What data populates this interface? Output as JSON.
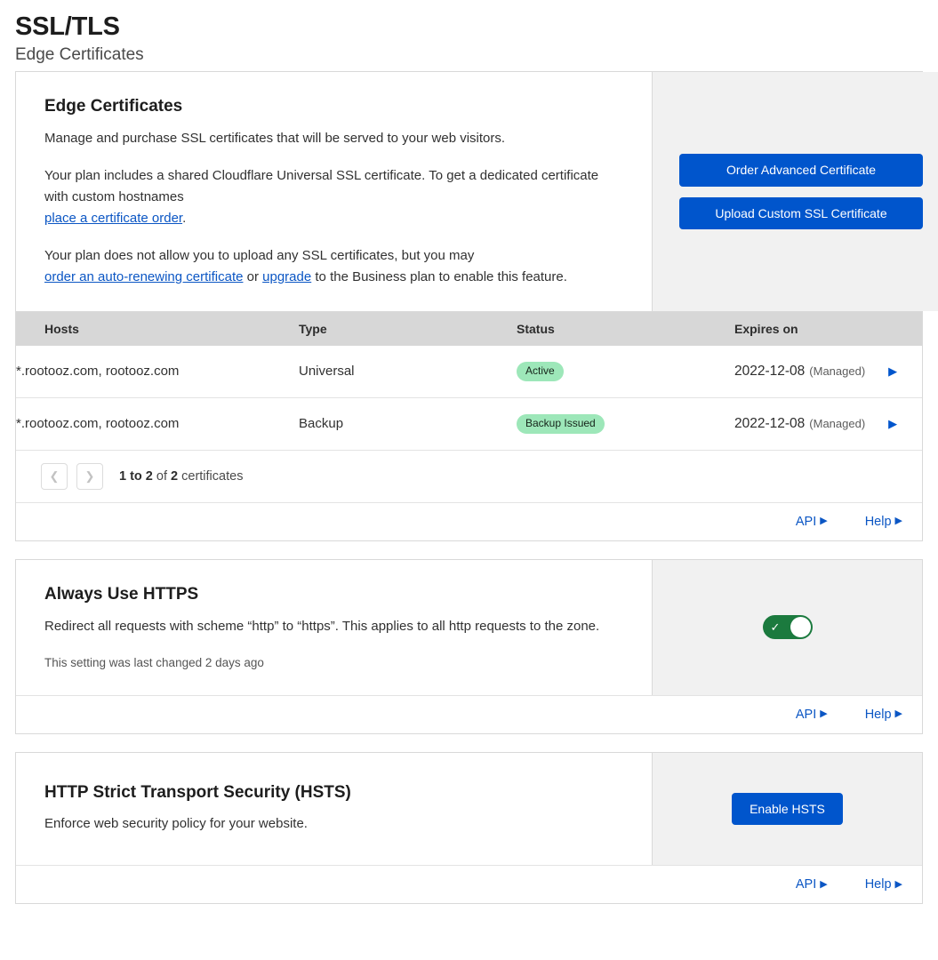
{
  "header": {
    "title": "SSL/TLS",
    "subtitle": "Edge Certificates"
  },
  "edge_certificates": {
    "title": "Edge Certificates",
    "desc_1": "Manage and purchase SSL certificates that will be served to your web visitors.",
    "desc_2_part1": "Your plan includes a shared Cloudflare Universal SSL certificate. To get a dedicated certificate with custom hostnames",
    "desc_2_link": "place a certificate order",
    "desc_2_end": ".",
    "desc_3_part1": "Your plan does not allow you to upload any SSL certificates, but you may",
    "desc_3_link1": "order an auto-renewing certificate",
    "desc_3_mid": " or ",
    "desc_3_link2": "upgrade",
    "desc_3_end": " to the Business plan to enable this feature.",
    "order_button": "Order Advanced Certificate",
    "upload_button": "Upload Custom SSL Certificate",
    "table": {
      "columns": [
        "Hosts",
        "Type",
        "Status",
        "Expires on"
      ],
      "rows": [
        {
          "hosts": "*.rootooz.com, rootooz.com",
          "type": "Universal",
          "status": "Active",
          "expires_date": "2022-12-08",
          "expires_managed": "(Managed)",
          "expand_icon": "caret-right-icon"
        },
        {
          "hosts": "*.rootooz.com, rootooz.com",
          "type": "Backup",
          "status": "Backup Issued",
          "expires_date": "2022-12-08",
          "expires_managed": "(Managed)",
          "expand_icon": "caret-right-icon"
        }
      ]
    },
    "pagination": {
      "prev_icon": "chevron-left-icon",
      "next_icon": "chevron-right-icon",
      "range": "1 to 2",
      "of": " of ",
      "total": "2",
      "unit": " certificates"
    },
    "footer": {
      "api": "API",
      "help": "Help"
    }
  },
  "always_use_https": {
    "title": "Always Use HTTPS",
    "description": "Redirect all requests with scheme “http” to “https”. This applies to all http requests to the zone.",
    "last_changed": "This setting was last changed 2 days ago",
    "toggle": {
      "state": "on",
      "icon": "check-icon"
    },
    "footer": {
      "api": "API",
      "help": "Help"
    }
  },
  "hsts": {
    "title": "HTTP Strict Transport Security (HSTS)",
    "description": "Enforce web security policy for your website.",
    "enable_button": "Enable HSTS",
    "footer": {
      "api": "API",
      "help": "Help"
    }
  },
  "colors": {
    "primary_blue": "#0055cc",
    "link_blue": "#0b56c4",
    "badge_green": "#9de7b9",
    "toggle_green": "#1b7a3e",
    "panel_grey": "#f1f1f1",
    "table_header_grey": "#d7d7d7"
  }
}
